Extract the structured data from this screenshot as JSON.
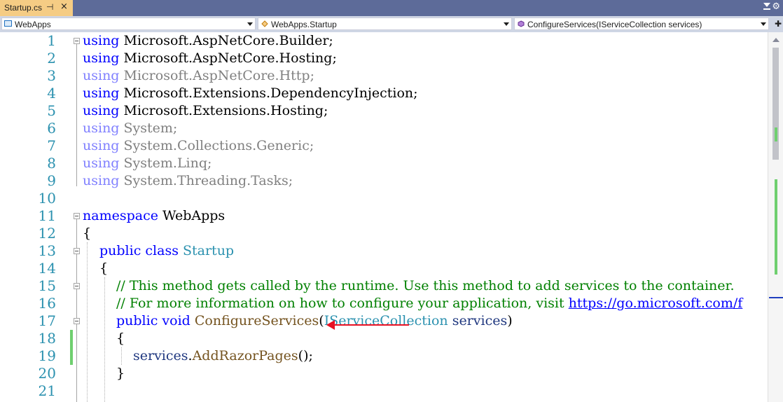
{
  "tab": {
    "title": "Startup.cs",
    "pin": "⊣",
    "close": "×"
  },
  "nav": {
    "project": "WebApps",
    "class": "WebApps.Startup",
    "member": "ConfigureServices(IServiceCollection services)"
  },
  "lines": [
    {
      "n": "1"
    },
    {
      "n": "2"
    },
    {
      "n": "3"
    },
    {
      "n": "4"
    },
    {
      "n": "5"
    },
    {
      "n": "6"
    },
    {
      "n": "7"
    },
    {
      "n": "8"
    },
    {
      "n": "9"
    },
    {
      "n": "10"
    },
    {
      "n": "11"
    },
    {
      "n": "12"
    },
    {
      "n": "13"
    },
    {
      "n": "14"
    },
    {
      "n": "15"
    },
    {
      "n": "16"
    },
    {
      "n": "17"
    },
    {
      "n": "18"
    },
    {
      "n": "19"
    },
    {
      "n": "20"
    },
    {
      "n": "21"
    }
  ],
  "code": {
    "l1": {
      "kw": "using",
      "rest": " Microsoft.AspNetCore.Builder;"
    },
    "l2": {
      "kw": "using",
      "rest": " Microsoft.AspNetCore.Hosting;"
    },
    "l3": {
      "kw": "using",
      "rest": " Microsoft.AspNetCore.Http;"
    },
    "l4": {
      "kw": "using",
      "rest": " Microsoft.Extensions.DependencyInjection;"
    },
    "l5": {
      "kw": "using",
      "rest": " Microsoft.Extensions.Hosting;"
    },
    "l6": {
      "kw": "using",
      "rest": " System;"
    },
    "l7": {
      "kw": "using",
      "rest": " System.Collections.Generic;"
    },
    "l8": {
      "kw": "using",
      "rest": " System.Linq;"
    },
    "l9": {
      "kw": "using",
      "rest": " System.Threading.Tasks;"
    },
    "l11": {
      "kw": "namespace",
      "rest": " WebApps"
    },
    "l12": {
      "text": "{"
    },
    "l13": {
      "kw": "public class",
      "type": "Startup"
    },
    "l14": {
      "text": "{"
    },
    "l15": {
      "comment": "// This method gets called by the runtime. Use this method to add services to the container."
    },
    "l16": {
      "comment": "// For more information on how to configure your application, visit ",
      "link": "https://go.microsoft.com/f"
    },
    "l17": {
      "kw": "public void",
      "method": "ConfigureServices",
      "open": "(",
      "type": "IServiceCollection",
      "param": "services",
      "close": ")"
    },
    "l18": {
      "text": "{"
    },
    "l19": {
      "param": "services",
      "dot": ".",
      "method": "AddRazorPages",
      "tail": "();"
    },
    "l20": {
      "text": "}"
    }
  },
  "colors": {
    "keyword": "#0000ff",
    "type": "#2b91af",
    "comment": "#008000",
    "annotation_arrow": "#e81123",
    "change_bar": "#6fcf6f"
  }
}
